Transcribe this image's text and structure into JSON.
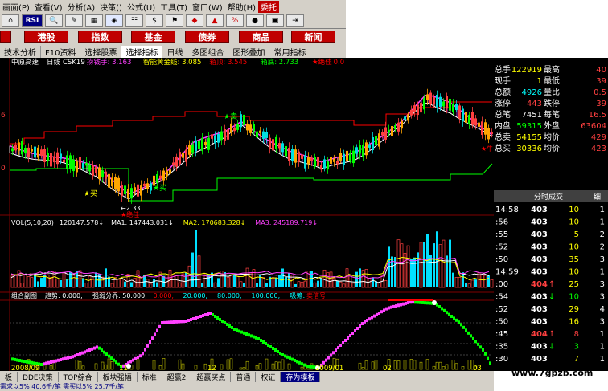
{
  "menu": [
    "画面(P)",
    "查看(V)",
    "分析(A)",
    "决策()",
    "公式(U)",
    "工具(T)",
    "窗口(W)",
    "帮助(H)",
    "委托"
  ],
  "toolbar": {
    "rsi_label": "RSI"
  },
  "categories": [
    "港股",
    "指数",
    "基金",
    "债券",
    "商品",
    "新闻"
  ],
  "funcbar": [
    "技术分析",
    "F10资料",
    "选择股票",
    "选择指标",
    "日线",
    "多图组合",
    "图形叠加",
    "常用指标"
  ],
  "chart": {
    "header_stock": "中原高速",
    "header_period": "日线",
    "header_formula": "CSK19",
    "header_items": [
      {
        "label": "捞钱手: 3.163",
        "color": "#ff40ff"
      },
      {
        "label": "智能黄金线: 3.085",
        "color": "#ffff00"
      },
      {
        "label": "箱顶: 3.545",
        "color": "#ff0000"
      },
      {
        "label": "箱底: 2.733",
        "color": "#00ff00"
      },
      {
        "label": "★绝佳",
        "color": "#ff0000"
      },
      {
        "label": "0.0",
        "color": "#ff0000"
      }
    ],
    "y_labels": [
      "6",
      "0"
    ],
    "annotations": {
      "sell": "卖",
      "buy": "买",
      "low": "2.33",
      "best": "★绝佳",
      "pick": "★牛"
    },
    "vol_header": "VOL(5,10,20)",
    "vol_items": [
      {
        "label": "120147.578↓",
        "color": "#ffffff"
      },
      {
        "label": "MA1: 147443.031↓",
        "color": "#ffffff"
      },
      {
        "label": "MA2: 170683.328↓",
        "color": "#ffff00"
      },
      {
        "label": "MA3: 245189.719↓",
        "color": "#ff40ff"
      }
    ],
    "ind_header": "组合副图",
    "ind_items": [
      {
        "label": "趋势: 0.000,",
        "color": "#ffffff"
      },
      {
        "label": "强弱分界: 50.000,",
        "color": "#ffffff"
      },
      {
        "label": "0.000,",
        "color": "#ff0000"
      },
      {
        "label": "20.000,",
        "color": "#00ffff"
      },
      {
        "label": "80.000,",
        "color": "#00ffff"
      },
      {
        "label": "100.000,",
        "color": "#00ffff"
      },
      {
        "label": "吸筹:",
        "color": "#00ffff"
      },
      {
        "label": "卖信号",
        "color": "#ff0000"
      }
    ],
    "x_labels": [
      "2008/09",
      "11",
      "12",
      "2009/01",
      "02",
      "03"
    ]
  },
  "quote": [
    {
      "l": "总额",
      "v": "",
      "l2": "",
      "v2": ""
    },
    {
      "l": "总手",
      "v": "122919",
      "vc": "#ffff00",
      "l2": "最高",
      "v2": "40"
    },
    {
      "l": "现手",
      "v": "1",
      "vc": "#ffff00",
      "l2": "最低",
      "v2": "39"
    },
    {
      "l": "总额",
      "v": "4926",
      "vc": "#00ffff",
      "l2": "量比",
      "v2": "0.5"
    },
    {
      "l": "涨停",
      "v": "443",
      "vc": "#ff4040",
      "l2": "跌停",
      "v2": "39"
    },
    {
      "l": "总笔",
      "v": "7451",
      "vc": "#ffffff",
      "l2": "每笔",
      "v2": "16.5"
    },
    {
      "l": "内盘",
      "v": "59315",
      "vc": "#00ff00",
      "l2": "外盘",
      "v2": "63604"
    },
    {
      "l": "总卖",
      "v": "54155",
      "vc": "#ffff00",
      "l2": "均价",
      "v2": "429"
    },
    {
      "l": "总买",
      "v": "30336",
      "vc": "#ffff00",
      "l2": "均价",
      "v2": "423"
    }
  ],
  "ticks_tab": {
    "label": "分时成交",
    "extra": "细"
  },
  "ticks": [
    {
      "t": "14:58",
      "p": "403",
      "pc": "#ffffff",
      "a": "",
      "v": "10",
      "vc": "#ffff00",
      "n": "1"
    },
    {
      "t": ":56",
      "p": "403",
      "pc": "#ffffff",
      "a": "",
      "v": "10",
      "vc": "#ffff00",
      "n": "1"
    },
    {
      "t": ":55",
      "p": "403",
      "pc": "#ffffff",
      "a": "",
      "v": "5",
      "vc": "#ffff00",
      "n": "2"
    },
    {
      "t": ":52",
      "p": "403",
      "pc": "#ffffff",
      "a": "",
      "v": "10",
      "vc": "#ffff00",
      "n": "2"
    },
    {
      "t": ":50",
      "p": "403",
      "pc": "#ffffff",
      "a": "",
      "v": "35",
      "vc": "#ffff00",
      "n": "3"
    },
    {
      "t": "14:59",
      "p": "403",
      "pc": "#ffffff",
      "a": "",
      "v": "10",
      "vc": "#ffff00",
      "n": "1"
    },
    {
      "t": ":00",
      "p": "404",
      "pc": "#ff4040",
      "a": "↑",
      "v": "25",
      "vc": "#ffff00",
      "n": "3"
    },
    {
      "t": ":54",
      "p": "403",
      "pc": "#ffffff",
      "a": "↓",
      "v": "10",
      "vc": "#00ff00",
      "n": "3"
    },
    {
      "t": ":52",
      "p": "403",
      "pc": "#ffffff",
      "a": "",
      "v": "29",
      "vc": "#ffff00",
      "n": "4"
    },
    {
      "t": ":50",
      "p": "403",
      "pc": "#ffffff",
      "a": "",
      "v": "16",
      "vc": "#ffff00",
      "n": "3"
    },
    {
      "t": ":45",
      "p": "404",
      "pc": "#ff4040",
      "a": "↑",
      "v": "8",
      "vc": "#ff4040",
      "n": "1"
    },
    {
      "t": ":35",
      "p": "403",
      "pc": "#ffffff",
      "a": "↓",
      "v": "3",
      "vc": "#00ff00",
      "n": "1"
    },
    {
      "t": ":30",
      "p": "403",
      "pc": "#ffffff",
      "a": "",
      "v": "7",
      "vc": "#ffff00",
      "n": "1"
    }
  ],
  "bottom_tabs": [
    "板",
    "DDE决策",
    "TOP综合",
    "板块强幅",
    "标准",
    "超赢2",
    "超赢买点",
    "普通",
    "权证",
    "存为模板"
  ],
  "status": "需求以5%  40.6千/笔    需买以5%  25.7千/笔",
  "watermark": "www.7gpzb.com"
}
